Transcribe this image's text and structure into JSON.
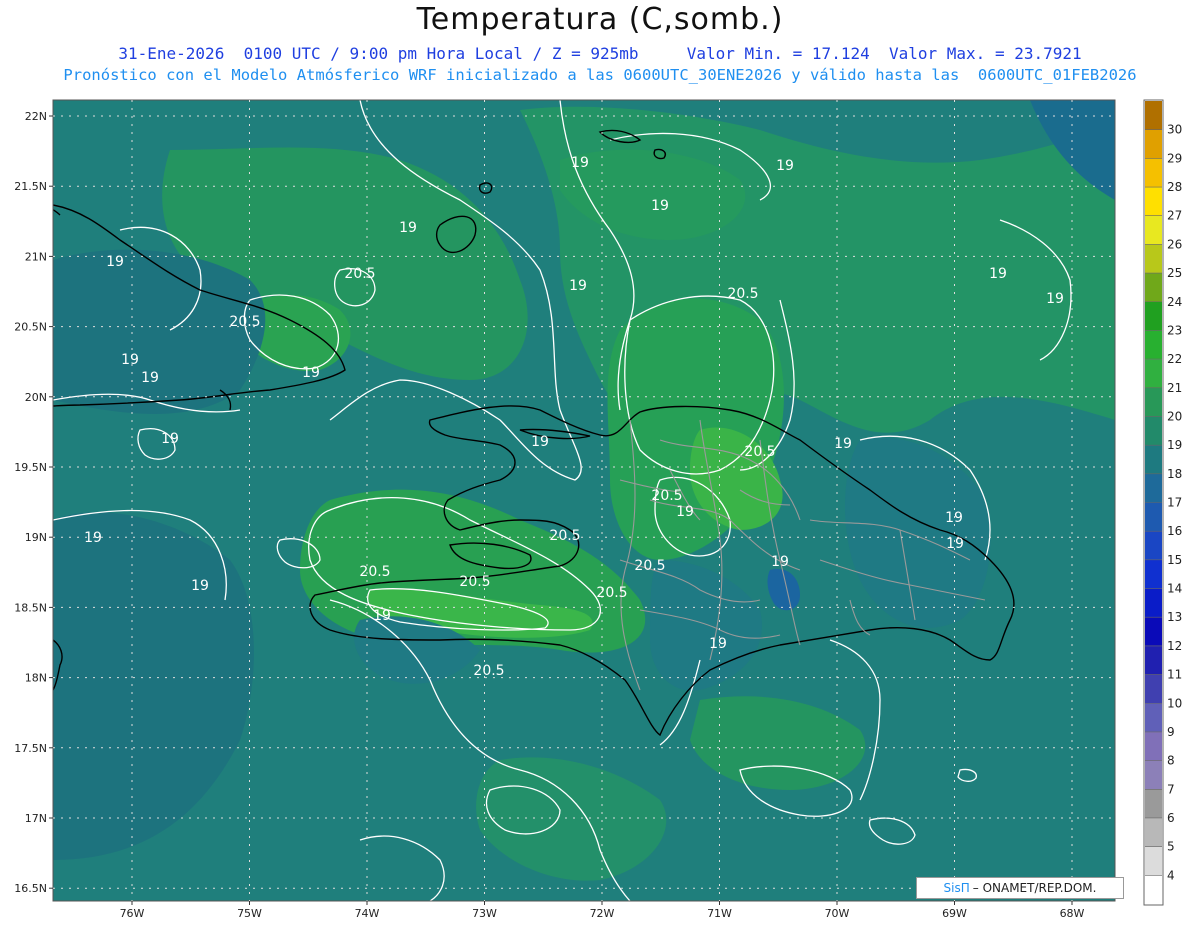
{
  "header": {
    "title": "Temperatura (C,somb.)",
    "line1": "31-Ene-2026  0100 UTC / 9:00 pm Hora Local / Z = 925mb     Valor Min. = 17.124  Valor Max. = 23.7921",
    "line2": "Pronóstico con el Modelo Atmósferico WRF inicializado a las 0600UTC_30ENE2026 y válido hasta las  0600UTC_01FEB2026"
  },
  "map": {
    "lat_labels": [
      "22N",
      "21.5N",
      "21N",
      "20.5N",
      "20N",
      "19.5N",
      "19N",
      "18.5N",
      "18N",
      "17.5N",
      "17N",
      "16.5N"
    ],
    "lon_labels": [
      "76W",
      "75W",
      "74W",
      "73W",
      "72W",
      "71W",
      "70W",
      "69W",
      "68W"
    ],
    "contour_labels": [
      "19",
      "19",
      "19",
      "19",
      "19",
      "19",
      "19",
      "19",
      "19",
      "19",
      "19",
      "19",
      "19",
      "19",
      "19",
      "19",
      "19",
      "19",
      "19",
      "19",
      "19",
      "19",
      "20.5",
      "20.5",
      "20.5",
      "20.5",
      "20.5",
      "20.5",
      "20.5",
      "20.5",
      "20.5",
      "20.5",
      "20.5"
    ],
    "colors": {
      "cool": "#1f7a84",
      "mid": "#22a06a",
      "warm": "#33b24a",
      "contour": "#ffffff",
      "coast": "#000000",
      "province": "#9a9a9a"
    }
  },
  "colorbar": {
    "labels": [
      "30",
      "29",
      "28",
      "27",
      "26",
      "25",
      "24",
      "23",
      "22",
      "21",
      "20",
      "19",
      "18",
      "17",
      "16",
      "15",
      "14",
      "13",
      "12",
      "11",
      "10",
      "9",
      "8",
      "7",
      "6",
      "5",
      "4"
    ],
    "colors": [
      "#b07000",
      "#e0a000",
      "#f5c000",
      "#ffe000",
      "#e8e820",
      "#b8c81a",
      "#70a81a",
      "#20a020",
      "#28b030",
      "#30b040",
      "#289858",
      "#228a6a",
      "#1e7a80",
      "#1e6a9a",
      "#1e5ab0",
      "#1a46c4",
      "#1030d0",
      "#0a1cc8",
      "#0a0ab8",
      "#2020b0",
      "#4040b0",
      "#6060b8",
      "#8070b8",
      "#8c80b8",
      "#9a9a9a",
      "#b8b8b8",
      "#dcdcdc",
      "#ffffff"
    ]
  },
  "credit": {
    "brand": "SisΠ",
    "text": "– ONAMET/REP.DOM."
  }
}
